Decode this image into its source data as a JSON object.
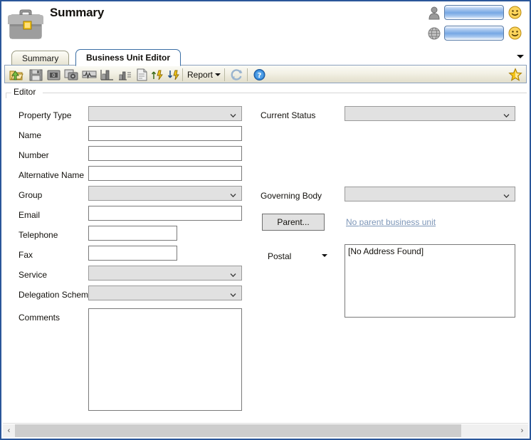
{
  "window": {
    "border_color": "#2a5699"
  },
  "header": {
    "title": "Summary",
    "app_icon": "briefcase-icon",
    "user_rows": [
      {
        "icon": "user-icon",
        "value": "",
        "status_icon": "smiley-icon"
      },
      {
        "icon": "globe-icon",
        "value": "",
        "status_icon": "smiley-icon"
      }
    ]
  },
  "tabs": {
    "items": [
      {
        "label": "Summary",
        "active": false
      },
      {
        "label": "Business Unit Editor",
        "active": true
      }
    ],
    "overflow_icon": "chevron-down-icon"
  },
  "toolbar": {
    "icons": [
      "open-folder-icon",
      "save-icon",
      "snapshot-icon",
      "screenshot-icon",
      "chart-line-icon",
      "bar-chart-icon",
      "bar-chart-list-icon",
      "document-icon",
      "sort-ascending-icon",
      "sort-descending-icon"
    ],
    "report_label": "Report",
    "report_dropdown_icon": "caret-down-icon",
    "refresh_icon": "refresh-icon",
    "help_icon": "help-icon",
    "favourite_icon": "star-icon"
  },
  "groupbox": {
    "label": "Editor"
  },
  "form": {
    "left_fields": [
      {
        "label": "Property Type",
        "type": "combo",
        "value": ""
      },
      {
        "label": "Name",
        "type": "text",
        "value": ""
      },
      {
        "label": "Number",
        "type": "text",
        "value": ""
      },
      {
        "label": "Alternative Name",
        "type": "text",
        "value": ""
      },
      {
        "label": "Group",
        "type": "combo",
        "value": ""
      },
      {
        "label": "Email",
        "type": "text",
        "value": ""
      },
      {
        "label": "Telephone",
        "type": "text",
        "value": ""
      },
      {
        "label": "Fax",
        "type": "text",
        "value": ""
      },
      {
        "label": "Service",
        "type": "combo",
        "value": ""
      },
      {
        "label": "Delegation Scheme",
        "type": "combo",
        "value": ""
      },
      {
        "label": "Comments",
        "type": "textarea",
        "value": ""
      }
    ],
    "right_fields": [
      {
        "label": "Current Status",
        "type": "combo",
        "value": ""
      },
      {
        "label": "Governing Body",
        "type": "combo",
        "value": ""
      }
    ],
    "parent_button_label": "Parent...",
    "parent_link_text": "No parent business unit",
    "postal_label": "Postal",
    "postal_dropdown_icon": "caret-down-icon",
    "postal_value": "[No Address Found]"
  },
  "footer": {
    "scroll_left_icon": "chevron-left-icon",
    "scroll_right_icon": "chevron-right-icon",
    "scroll_left_glyph": "‹",
    "scroll_right_glyph": "›"
  }
}
